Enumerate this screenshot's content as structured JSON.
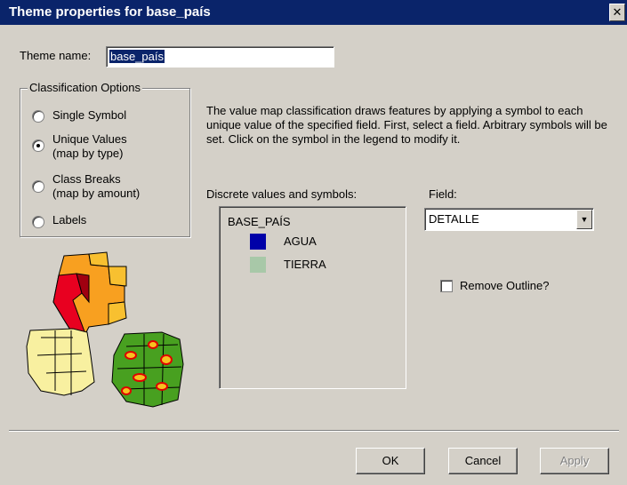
{
  "window": {
    "title": "Theme properties for base_país",
    "close_glyph": "✕"
  },
  "theme_name": {
    "label": "Theme name:",
    "value": "base_país"
  },
  "classification": {
    "legend": "Classification Options",
    "options": [
      {
        "label": "Single Symbol",
        "sub": "",
        "selected": false
      },
      {
        "label": "Unique Values",
        "sub": "(map by type)",
        "selected": true
      },
      {
        "label": "Class Breaks",
        "sub": "(map by amount)",
        "selected": false
      },
      {
        "label": "Labels",
        "sub": "",
        "selected": false
      }
    ]
  },
  "description": "The value map classification draws features by applying a symbol to each unique value of the specified field. First, select a field. Arbitrary symbols will be set. Click on the symbol in the legend to modify it.",
  "discrete": {
    "label": "Discrete values and symbols:",
    "header": "BASE_PAÍS",
    "items": [
      {
        "label": "AGUA",
        "color": "#0000a8"
      },
      {
        "label": "TIERRA",
        "color": "#a8c8a8"
      }
    ]
  },
  "field": {
    "label": "Field:",
    "value": "DETALLE",
    "arrow": "▼"
  },
  "remove_outline": {
    "label": "Remove Outline?",
    "checked": false
  },
  "buttons": {
    "ok": "OK",
    "cancel": "Cancel",
    "apply": "Apply"
  }
}
